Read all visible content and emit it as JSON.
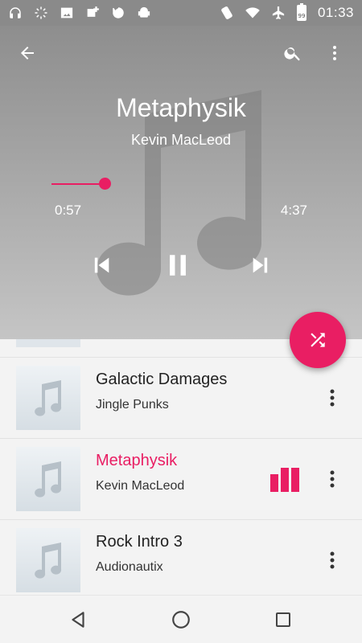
{
  "status_bar": {
    "left_icons": [
      "headphones-icon",
      "loading-icon",
      "image-icon",
      "sync-add-icon",
      "cloud-sync-icon",
      "android-icon"
    ],
    "right_icons": [
      "rotate-icon",
      "wifi-icon",
      "airplane-icon",
      "battery-icon"
    ],
    "battery_level": "99",
    "time": "01:33"
  },
  "player": {
    "title": "Metaphysik",
    "artist": "Kevin MacLeod",
    "elapsed": "0:57",
    "total": "4:37",
    "progress_fraction": 0.206,
    "state": "playing"
  },
  "accent_color": "#e91e63",
  "playlist": [
    {
      "title": "Galactic Damages",
      "artist": "Jingle Punks",
      "active": false
    },
    {
      "title": "Metaphysik",
      "artist": "Kevin MacLeod",
      "active": true
    },
    {
      "title": "Rock Intro 3",
      "artist": "Audionautix",
      "active": false
    }
  ]
}
